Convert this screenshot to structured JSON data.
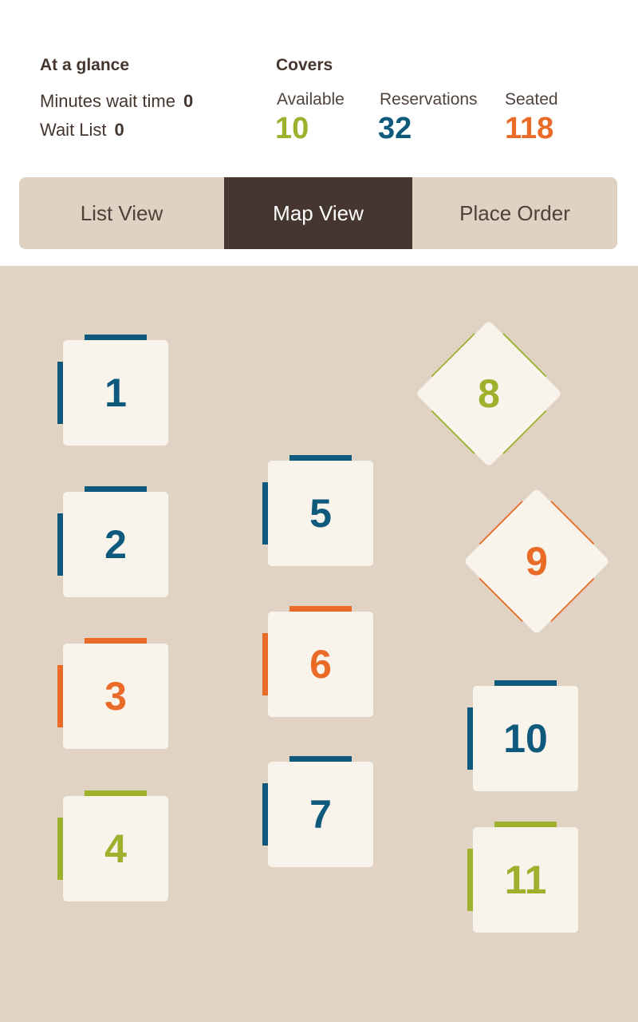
{
  "header": {
    "glance_title": "At a glance",
    "wait_time_label": "Minutes wait time",
    "wait_time_value": "0",
    "wait_list_label": "Wait List",
    "wait_list_value": "0",
    "covers_title": "Covers",
    "available_label": "Available",
    "available_value": "10",
    "reservations_label": "Reservations",
    "reservations_value": "32",
    "seated_label": "Seated",
    "seated_value": "118"
  },
  "tabs": [
    {
      "label": "List View",
      "active": false
    },
    {
      "label": "Map View",
      "active": true
    },
    {
      "label": "Place Order",
      "active": false
    }
  ],
  "colors": {
    "available": "#9db12d",
    "reserved": "#0f5a7c",
    "seated": "#e96b27"
  },
  "tables": [
    {
      "number": "1",
      "status": "reserved",
      "shape": "square"
    },
    {
      "number": "2",
      "status": "reserved",
      "shape": "square"
    },
    {
      "number": "3",
      "status": "seated",
      "shape": "square"
    },
    {
      "number": "4",
      "status": "available",
      "shape": "square"
    },
    {
      "number": "5",
      "status": "reserved",
      "shape": "square"
    },
    {
      "number": "6",
      "status": "seated",
      "shape": "square"
    },
    {
      "number": "7",
      "status": "reserved",
      "shape": "square"
    },
    {
      "number": "8",
      "status": "available",
      "shape": "diamond"
    },
    {
      "number": "9",
      "status": "seated",
      "shape": "diamond"
    },
    {
      "number": "10",
      "status": "reserved",
      "shape": "square"
    },
    {
      "number": "11",
      "status": "available",
      "shape": "square"
    }
  ]
}
